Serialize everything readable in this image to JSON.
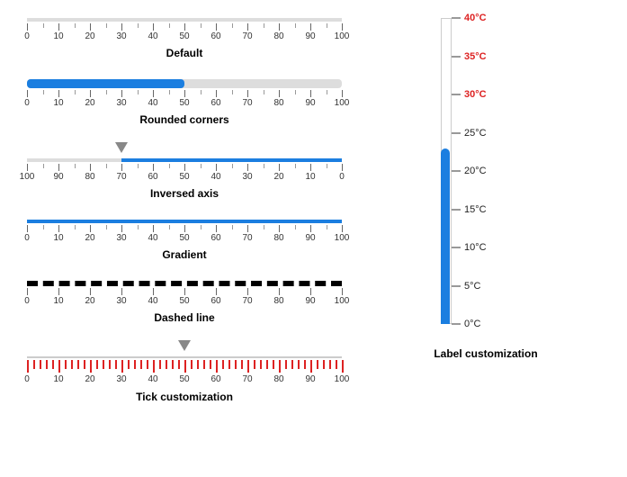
{
  "chart_data": [
    {
      "type": "bar",
      "title": "Default",
      "xlabel": "",
      "ylabel": "",
      "categories": [
        0,
        10,
        20,
        30,
        40,
        50,
        60,
        70,
        80,
        90,
        100
      ],
      "values": [
        0
      ],
      "range": [
        0,
        100
      ],
      "minor_step": 5,
      "pointer": null,
      "reverse": false
    },
    {
      "type": "bar",
      "title": "Rounded corners",
      "xlabel": "",
      "ylabel": "",
      "categories": [
        0,
        10,
        20,
        30,
        40,
        50,
        60,
        70,
        80,
        90,
        100
      ],
      "values": [
        50
      ],
      "range": [
        0,
        100
      ],
      "minor_step": 5,
      "pointer": null,
      "reverse": false
    },
    {
      "type": "bar",
      "title": "Inversed axis",
      "xlabel": "",
      "ylabel": "",
      "categories": [
        100,
        90,
        80,
        70,
        60,
        50,
        40,
        30,
        20,
        10,
        0
      ],
      "values": [
        70
      ],
      "range": [
        0,
        100
      ],
      "minor_step": 5,
      "pointer": 70,
      "reverse": true
    },
    {
      "type": "bar",
      "title": "Gradient",
      "xlabel": "",
      "ylabel": "",
      "categories": [
        0,
        10,
        20,
        30,
        40,
        50,
        60,
        70,
        80,
        90,
        100
      ],
      "values": [
        100
      ],
      "range": [
        0,
        100
      ],
      "minor_step": 5,
      "pointer": null,
      "reverse": false
    },
    {
      "type": "bar",
      "title": "Dashed line",
      "xlabel": "",
      "ylabel": "",
      "categories": [
        0,
        10,
        20,
        30,
        40,
        50,
        60,
        70,
        80,
        90,
        100
      ],
      "values": [
        100
      ],
      "range": [
        0,
        100
      ],
      "minor_step": 0,
      "pointer": null,
      "reverse": false
    },
    {
      "type": "bar",
      "title": "Tick customization",
      "xlabel": "",
      "ylabel": "",
      "categories": [
        0,
        10,
        20,
        30,
        40,
        50,
        60,
        70,
        80,
        90,
        100
      ],
      "values": [
        50
      ],
      "range": [
        0,
        100
      ],
      "minor_step": 2,
      "pointer": 50,
      "reverse": false
    }
  ],
  "vertical": {
    "type": "bar",
    "title": "Label customization",
    "range": [
      0,
      40
    ],
    "unit": "°C",
    "value": 23,
    "ticks": [
      {
        "v": 40,
        "color": "red"
      },
      {
        "v": 35,
        "color": "red"
      },
      {
        "v": 30,
        "color": "red"
      },
      {
        "v": 25,
        "color": "dark"
      },
      {
        "v": 20,
        "color": "dark"
      },
      {
        "v": 15,
        "color": "dark"
      },
      {
        "v": 10,
        "color": "dark"
      },
      {
        "v": 5,
        "color": "dark"
      },
      {
        "v": 0,
        "color": "dark"
      }
    ]
  },
  "captions": {
    "g0": "Default",
    "g1": "Rounded corners",
    "g2": "Inversed axis",
    "g3": "Gradient",
    "g4": "Dashed line",
    "g5": "Tick customization",
    "v": "Label customization"
  }
}
